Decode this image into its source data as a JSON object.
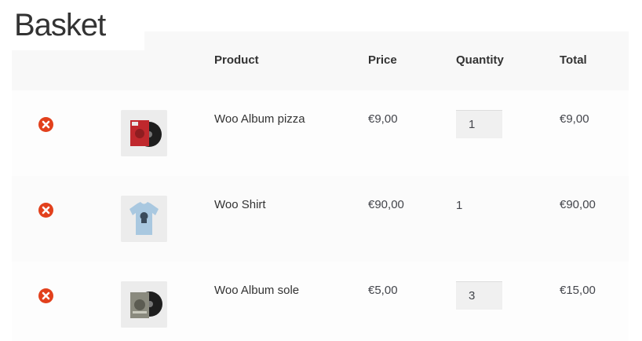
{
  "page": {
    "title": "Basket"
  },
  "table": {
    "headers": {
      "product": "Product",
      "price": "Price",
      "quantity": "Quantity",
      "total": "Total"
    },
    "items": [
      {
        "name": "Woo Album pizza",
        "price": "€9,00",
        "quantity": "1",
        "quantity_editable": true,
        "total": "€9,00",
        "thumbnail_icon": "album-pizza-icon"
      },
      {
        "name": "Woo Shirt",
        "price": "€90,00",
        "quantity": "1",
        "quantity_editable": false,
        "total": "€90,00",
        "thumbnail_icon": "shirt-icon"
      },
      {
        "name": "Woo Album sole",
        "price": "€5,00",
        "quantity": "3",
        "quantity_editable": true,
        "total": "€15,00",
        "thumbnail_icon": "album-sole-icon"
      }
    ]
  },
  "colors": {
    "remove": "#e2401c",
    "header_bg": "#f8f8f8",
    "text": "#43454b"
  },
  "icons": {
    "remove": "remove-icon"
  }
}
